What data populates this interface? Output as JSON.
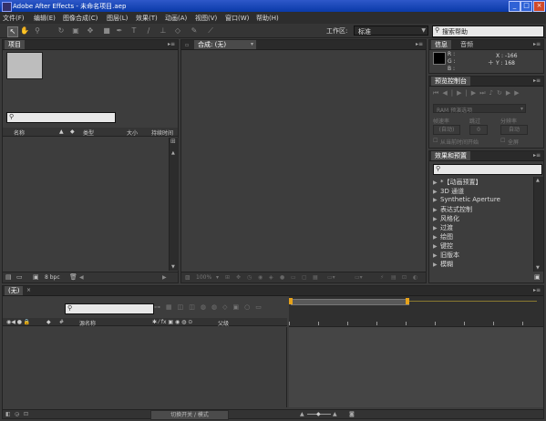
{
  "window": {
    "title": "Adobe After Effects - 未命名项目.aep",
    "minimize": "_",
    "maximize": "□",
    "close": "×"
  },
  "menu": [
    "文件(F)",
    "编辑(E)",
    "图像合成(C)",
    "图层(L)",
    "效果(T)",
    "动画(A)",
    "视图(V)",
    "窗口(W)",
    "帮助(H)"
  ],
  "workspace": {
    "label": "工作区:",
    "value": "标准"
  },
  "search_help": {
    "placeholder": "搜索帮助"
  },
  "project_panel": {
    "tab": "项目",
    "columns": {
      "name": "名称",
      "type": "类型",
      "size": "大小",
      "duration": "持续时间"
    },
    "bpc": "8 bpc"
  },
  "comp_panel": {
    "tab": "合成: (无)",
    "zoom": "100%"
  },
  "info_panel": {
    "tabs": [
      "信息",
      "音频"
    ],
    "r": "R :",
    "g": "G :",
    "b": "B :",
    "x": "X : -166",
    "y": "Y : 168"
  },
  "preview_panel": {
    "tab": "预览控制台",
    "ram_options": "RAM 预演选项",
    "frame_rate_label": "帧速率",
    "skip_label": "跳过",
    "resolution_label": "分辨率",
    "frame_rate_value": "(自动)",
    "skip_value": "0",
    "resolution_value": "自动",
    "from_current": "从当前时间开始",
    "full_screen": "全屏"
  },
  "effects_panel": {
    "tab": "效果和预置",
    "items": [
      "*【动画预置】",
      "3D 通道",
      "Synthetic Aperture",
      "表达式控制",
      "风格化",
      "过渡",
      "绘图",
      "键控",
      "旧版本",
      "模糊"
    ]
  },
  "timeline": {
    "tab": "(无)",
    "columns": {
      "source_name": "源名称",
      "parent": "父级"
    },
    "toggle": "切换开关 / 模式"
  }
}
